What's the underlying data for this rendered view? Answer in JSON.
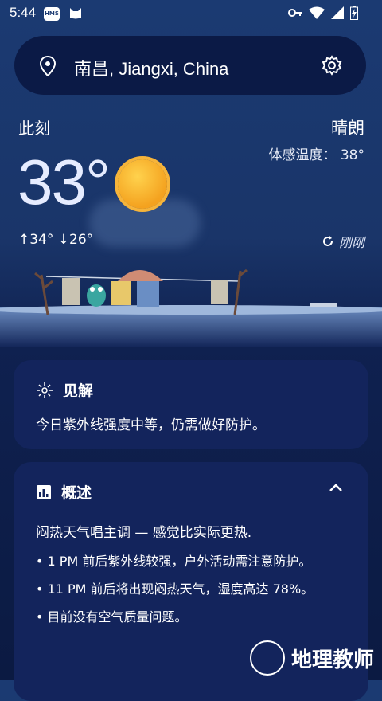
{
  "status_bar": {
    "time": "5:44",
    "hms_badge": "HMS"
  },
  "search": {
    "location": "南昌, Jiangxi, China"
  },
  "current": {
    "now_label": "此刻",
    "condition": "晴朗",
    "feels_like_label": "体感温度：",
    "feels_like_value": "38°",
    "temperature": "33°",
    "high": "↑34°",
    "low": "↓26°",
    "updated": "刚刚"
  },
  "insight": {
    "title": "见解",
    "text": "今日紫外线强度中等，仍需做好防护。"
  },
  "overview": {
    "title": "概述",
    "summary": "闷热天气唱主调 — 感觉比实际更热.",
    "bullets": [
      "• 1 PM 前后紫外线较强，户外活动需注意防护。",
      "• 11 PM 前后将出现闷热天气，湿度高达 78%。",
      "• 目前没有空气质量问题。"
    ]
  },
  "watermark": {
    "text": "地理教师"
  },
  "colors": {
    "card": "#13245c",
    "sun": "#f4a21f",
    "search_bg": "#0b1a46"
  }
}
